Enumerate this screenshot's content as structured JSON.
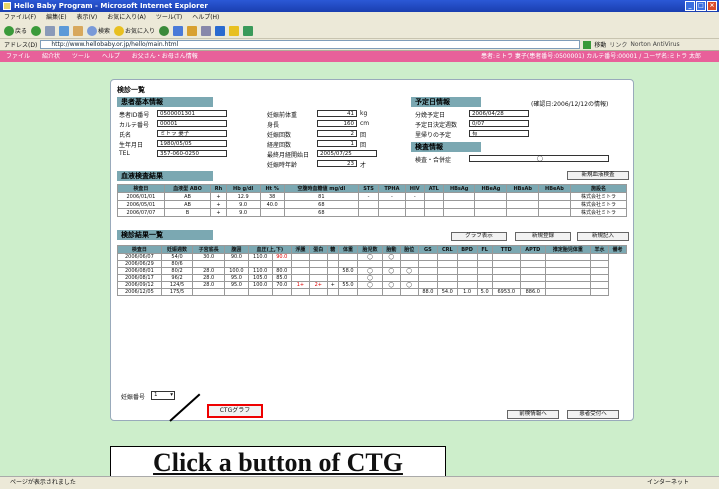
{
  "window": {
    "title": "Hello Baby Program - Microsoft Internet Explorer",
    "controls": [
      "_",
      "□",
      "×"
    ]
  },
  "menubar": [
    "ファイル(F)",
    "編集(E)",
    "表示(V)",
    "お気に入り(A)",
    "ツール(T)",
    "ヘルプ(H)"
  ],
  "toolbar": {
    "back": "戻る",
    "search": "検索",
    "favorites": "お気に入り"
  },
  "address": {
    "label": "アドレス(D)",
    "url": "http://www.hellobaby.or.jp/hello/main.html",
    "go": "移動",
    "links": "リンク",
    "norton": "Norton AntiVirus"
  },
  "appbar": {
    "items": [
      "ファイル",
      "紹介状",
      "ツール",
      "ヘルプ",
      "お父さん・お母さん情報"
    ],
    "info": "患者:ミトラ 妻子(患者番号:0500001) カルテ番号:00001 / ユーザ名:ミトラ 太郎"
  },
  "panel": {
    "title": "検診一覧",
    "patient": {
      "section": "患者基本情報",
      "fields": [
        {
          "label": "患者ID番号",
          "value": "0500001301"
        },
        {
          "label": "カルテ番号",
          "value": "00001"
        },
        {
          "label": "氏名",
          "value": "ミトラ 妻子"
        },
        {
          "label": "生年月日",
          "value": "1980/05/05"
        },
        {
          "label": "TEL",
          "value": "357-060-0250"
        }
      ],
      "right_fields": [
        {
          "label": "妊娠前体重",
          "value": "41",
          "unit": "kg"
        },
        {
          "label": "身長",
          "value": "160",
          "unit": "cm"
        },
        {
          "label": "妊娠回数",
          "value": "2",
          "unit": "回"
        },
        {
          "label": "経産回数",
          "value": "1",
          "unit": "回"
        },
        {
          "label": "最終月経開始日",
          "value": "2005/07/25",
          "unit": ""
        },
        {
          "label": "妊娠時年齢",
          "value": "23",
          "unit": "才"
        }
      ]
    },
    "schedule": {
      "section": "予定日情報",
      "note": "(確認日:2006/12/12の情報)",
      "fields": [
        {
          "label": "分娩予定日",
          "value": "2006/04/28"
        },
        {
          "label": "予定日決定週数",
          "value": "0/07"
        },
        {
          "label": "里帰りの予定",
          "value": "有"
        }
      ],
      "exam_section": "検査情報",
      "exam_fields": [
        {
          "label": "検査・合併症",
          "value": "◯"
        }
      ]
    },
    "blood": {
      "section": "血液検査結果",
      "button": "新規血液検査",
      "headers": [
        "検査日",
        "血液型 ABO",
        "Rh",
        "Hb g/dl",
        "Ht %",
        "空腹時血糖値 mg/dl",
        "STS",
        "TPHA",
        "HIV",
        "ATL",
        "HBsAg",
        "HBeAg",
        "HBsAb",
        "HBeAb",
        "施設名"
      ],
      "rows": [
        [
          "2006/01/01",
          "AB",
          "+",
          "12.9",
          "38",
          "81",
          "-",
          "-",
          "-",
          "",
          "",
          "",
          "",
          "",
          "株式会社ミトラ"
        ],
        [
          "2006/05/01",
          "AB",
          "+",
          "9.0",
          "40.0",
          "68",
          "",
          "",
          "",
          "",
          "",
          "",
          "",
          "",
          "株式会社ミトラ"
        ],
        [
          "2006/07/07",
          "B",
          "+",
          "9.0",
          "",
          "68",
          "",
          "",
          "",
          "",
          "",
          "",
          "",
          "",
          "株式会社ミトラ"
        ]
      ]
    },
    "checkup": {
      "section": "検診結果一覧",
      "buttons": [
        "グラフ表示",
        "新規登録",
        "新規記入"
      ],
      "headers": [
        "検査日",
        "妊娠週数",
        "子宮底長",
        "腹囲",
        "血圧(上,下)",
        "浮腫",
        "蛋白",
        "糖",
        "体重",
        "胎児数",
        "胎動",
        "胎位",
        "GS",
        "CRL",
        "BPD",
        "FL",
        "TTD",
        "APTD",
        "推定胎児体重",
        "羊水",
        "備考"
      ],
      "rows": [
        [
          "2006/06/07",
          "54/0",
          "30.0",
          "90.0",
          "110.0",
          "90.0",
          "",
          "",
          "",
          "",
          "◯",
          "◯",
          "",
          "",
          "",
          "",
          "",
          "",
          "",
          "",
          ""
        ],
        [
          "2006/06/29",
          "80/6",
          "",
          "",
          "",
          "",
          "",
          "",
          "",
          "",
          "",
          "",
          "",
          "",
          "",
          "",
          "",
          "",
          "",
          "",
          ""
        ],
        [
          "2006/08/01",
          "80/2",
          "28.0",
          "100.0",
          "110.0",
          "80.0",
          "",
          "",
          "",
          "58.0",
          "◯",
          "◯",
          "◯",
          "",
          "",
          "",
          "",
          "",
          "",
          "",
          ""
        ],
        [
          "2006/08/17",
          "96/2",
          "28.0",
          "95.0",
          "105.0",
          "85.0",
          "",
          "",
          "",
          "",
          "◯",
          "",
          "",
          "",
          "",
          "",
          "",
          "",
          "",
          "",
          ""
        ],
        [
          "2006/09/12",
          "124/5",
          "28.0",
          "95.0",
          "100.0",
          "70.0",
          "1+",
          "2+",
          "+",
          "55.0",
          "◯",
          "◯",
          "◯",
          "",
          "",
          "",
          "",
          "",
          "",
          "",
          ""
        ],
        [
          "2006/12/05",
          "175/5",
          "",
          "",
          "",
          "",
          "",
          "",
          "",
          "",
          "",
          "",
          "",
          "88.0",
          "54.0",
          "1.0",
          "5.0",
          "6953.0",
          "886.0",
          "",
          ""
        ]
      ],
      "pregnancy_label": "妊娠番号",
      "pregnancy_value": "1"
    },
    "ctg_button": "CTGグラフ",
    "bottom_buttons": [
      "前検情報へ",
      "患者受付へ"
    ]
  },
  "caption": "Click a button of CTG",
  "statusbar": {
    "left": "ページが表示されました",
    "zone": "インターネット"
  }
}
